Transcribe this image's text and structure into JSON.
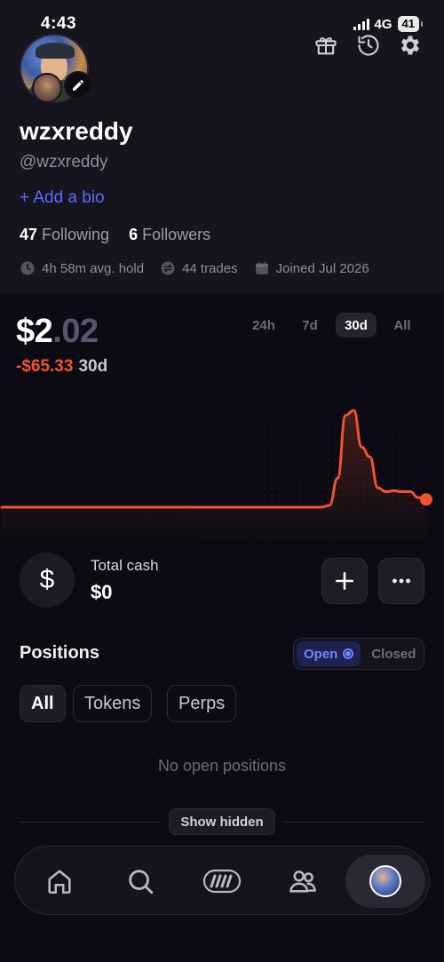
{
  "status_bar": {
    "time": "4:43",
    "network": "4G",
    "battery": "41"
  },
  "profile": {
    "username": "wzxreddy",
    "handle": "@wzxreddy",
    "add_bio": "+ Add a bio",
    "following_count": "47",
    "following_label": "Following",
    "followers_count": "6",
    "followers_label": "Followers",
    "avg_hold": "4h 58m avg. hold",
    "trades": "44 trades",
    "joined": "Joined Jul 2026"
  },
  "balance": {
    "dollars": "$2",
    "cents": ".02",
    "change": "-$65.33",
    "change_period": "30d",
    "ranges": [
      "24h",
      "7d",
      "30d",
      "All"
    ],
    "active_range": "30d"
  },
  "chart_data": {
    "type": "line",
    "series": [
      {
        "values": [
          0.0,
          0.0,
          0.0,
          0.0,
          0.0,
          0.0,
          0.0,
          0.0,
          0.0,
          0.0,
          0.0,
          0.0,
          0.0,
          0.0,
          0.0,
          0.0,
          0.0,
          0.0,
          0.02,
          0.3,
          0.95,
          1.0,
          0.62,
          0.52,
          0.2,
          0.16,
          0.17,
          0.16,
          0.16,
          0.1,
          0.08
        ]
      }
    ],
    "color": "#f0542e",
    "grid": false
  },
  "cash": {
    "label": "Total cash",
    "value": "$0"
  },
  "positions": {
    "title": "Positions",
    "toggle_open": "Open",
    "toggle_closed": "Closed",
    "filters": [
      "All",
      "Tokens",
      "Perps"
    ],
    "empty_text": "No open positions",
    "show_hidden": "Show hidden"
  },
  "tabbar": [
    "home-icon",
    "search-icon",
    "trade-icon",
    "people-icon",
    "profile-avatar"
  ]
}
